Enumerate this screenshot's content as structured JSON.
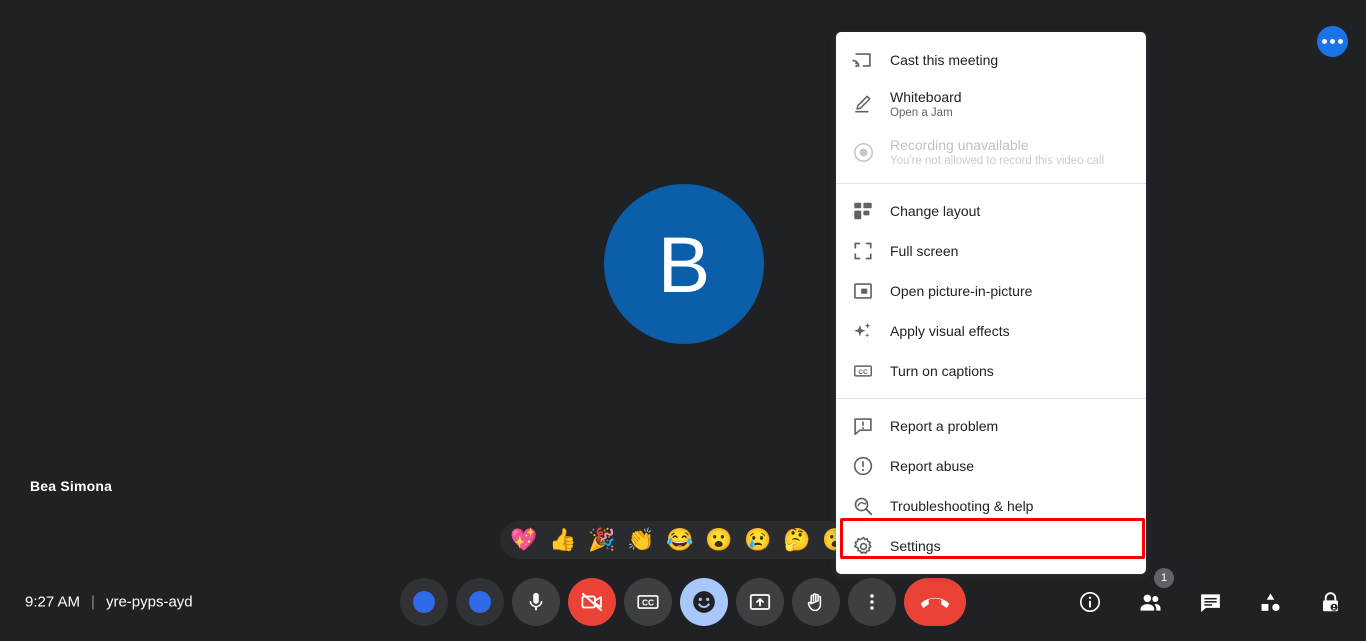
{
  "app": {
    "background_color": "#202124",
    "accent_color": "#1a73e8",
    "danger_color": "#ea4335",
    "highlight_color": "#f90000"
  },
  "top_bar": {
    "more_options_button": "more-options"
  },
  "stage": {
    "participant_initial": "B",
    "participant_name": "Bea Simona",
    "avatar_color": "#0b5ea8"
  },
  "reactions": {
    "emojis": [
      {
        "name": "sparkling-heart",
        "glyph": "💖"
      },
      {
        "name": "thumbs-up",
        "glyph": "👍"
      },
      {
        "name": "party-popper",
        "glyph": "🎉"
      },
      {
        "name": "clapping-hands",
        "glyph": "👏"
      },
      {
        "name": "face-with-tears-of-joy",
        "glyph": "😂"
      },
      {
        "name": "face-with-open-mouth",
        "glyph": "😮"
      },
      {
        "name": "crying-face",
        "glyph": "😢"
      },
      {
        "name": "thinking-face",
        "glyph": "🤔"
      },
      {
        "name": "partial-emoji",
        "glyph": "😮"
      }
    ]
  },
  "bottom_bar": {
    "time": "9:27 AM",
    "separator": "|",
    "meeting_code": "yre-pyps-ayd",
    "controls": [
      {
        "name": "loading-placeholder-1",
        "icon": "loading-dot",
        "label": ""
      },
      {
        "name": "loading-placeholder-2",
        "icon": "loading-dot",
        "label": ""
      },
      {
        "name": "microphone-button",
        "icon": "microphone-icon",
        "label": "Turn off microphone"
      },
      {
        "name": "camera-off-button",
        "icon": "camera-off-icon",
        "label": "Turn on camera"
      },
      {
        "name": "captions-button",
        "icon": "closed-captions-icon",
        "label": "Turn on captions"
      },
      {
        "name": "reactions-button",
        "icon": "smiley-face-icon",
        "label": "Send a reaction"
      },
      {
        "name": "present-now-button",
        "icon": "present-screen-icon",
        "label": "Present now"
      },
      {
        "name": "raise-hand-button",
        "icon": "raised-hand-icon",
        "label": "Raise hand"
      },
      {
        "name": "more-options-button",
        "icon": "three-dots-vertical-icon",
        "label": "More options"
      },
      {
        "name": "leave-call-button",
        "icon": "phone-hangup-icon",
        "label": "Leave call"
      }
    ],
    "right_controls": [
      {
        "name": "meeting-details-button",
        "icon": "info-icon",
        "badge": ""
      },
      {
        "name": "people-button",
        "icon": "people-icon",
        "badge": "1"
      },
      {
        "name": "chat-button",
        "icon": "chat-bubble-icon",
        "badge": ""
      },
      {
        "name": "activities-button",
        "icon": "activities-shapes-icon",
        "badge": ""
      },
      {
        "name": "host-controls-button",
        "icon": "lock-shield-icon",
        "badge": ""
      }
    ]
  },
  "options_menu": {
    "groups": [
      {
        "items": [
          {
            "name": "cast-this-meeting",
            "icon": "cast-icon",
            "title": "Cast this meeting",
            "subtitle": "",
            "disabled": false
          },
          {
            "name": "whiteboard",
            "icon": "pen-icon",
            "title": "Whiteboard",
            "subtitle": "Open a Jam",
            "disabled": false
          },
          {
            "name": "recording-unavailable",
            "icon": "record-circle-icon",
            "title": "Recording unavailable",
            "subtitle": "You're not allowed to record this video call",
            "disabled": true
          }
        ]
      },
      {
        "items": [
          {
            "name": "change-layout",
            "icon": "layout-grid-icon",
            "title": "Change layout",
            "subtitle": "",
            "disabled": false
          },
          {
            "name": "full-screen",
            "icon": "fullscreen-icon",
            "title": "Full screen",
            "subtitle": "",
            "disabled": false
          },
          {
            "name": "open-picture-in-picture",
            "icon": "picture-in-picture-icon",
            "title": "Open picture-in-picture",
            "subtitle": "",
            "disabled": false
          },
          {
            "name": "apply-visual-effects",
            "icon": "sparkles-icon",
            "title": "Apply visual effects",
            "subtitle": "",
            "disabled": false
          },
          {
            "name": "turn-on-captions",
            "icon": "closed-captions-icon",
            "title": "Turn on captions",
            "subtitle": "",
            "disabled": false
          }
        ]
      },
      {
        "items": [
          {
            "name": "report-a-problem",
            "icon": "report-problem-icon",
            "title": "Report a problem",
            "subtitle": "",
            "disabled": false
          },
          {
            "name": "report-abuse",
            "icon": "exclamation-circle-icon",
            "title": "Report abuse",
            "subtitle": "",
            "disabled": false
          },
          {
            "name": "troubleshooting-and-help",
            "icon": "troubleshoot-icon",
            "title": "Troubleshooting & help",
            "subtitle": "",
            "disabled": false
          },
          {
            "name": "settings",
            "icon": "gear-icon",
            "title": "Settings",
            "subtitle": "",
            "disabled": false,
            "highlighted": true
          }
        ]
      }
    ]
  }
}
